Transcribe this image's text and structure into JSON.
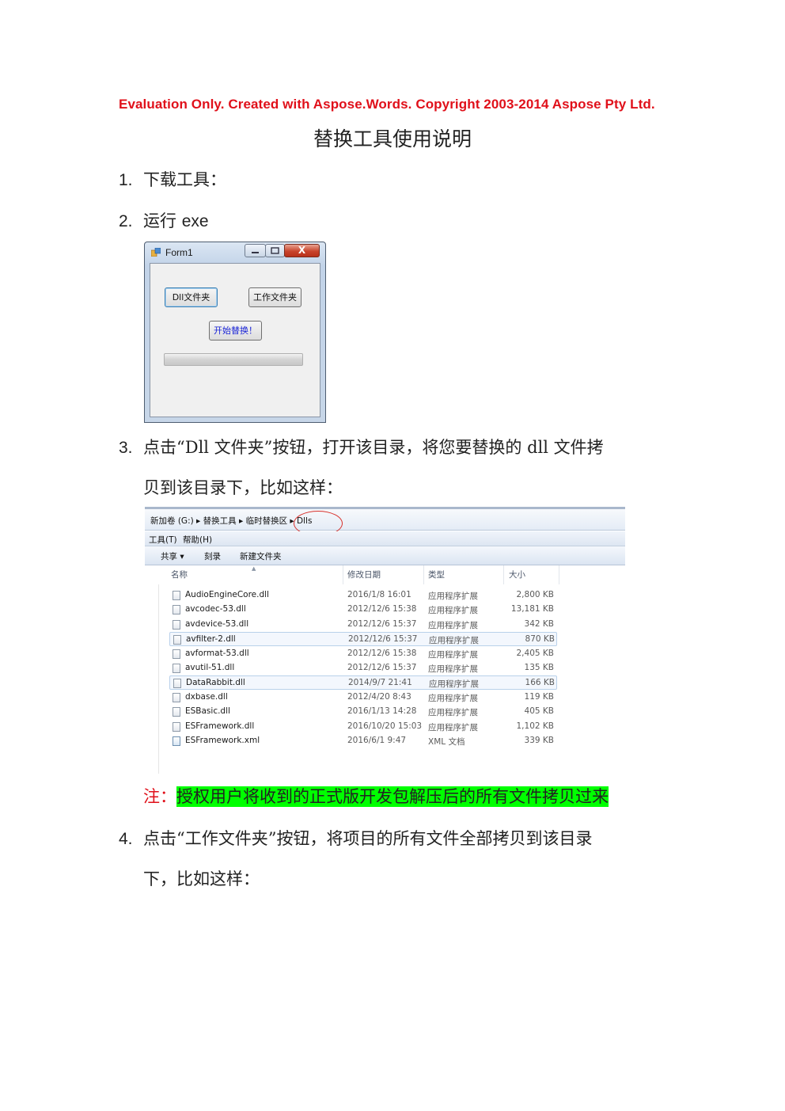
{
  "header": {
    "evaluation_notice": "Evaluation Only. Created with Aspose.Words. Copyright 2003-2014 Aspose Pty Ltd.",
    "title": "替换工具使用说明"
  },
  "steps": {
    "s1": {
      "num": "1.",
      "text": "下载工具："
    },
    "s2": {
      "num": "2.",
      "text_prefix": "运行 ",
      "text_latin": "exe"
    },
    "s3": {
      "num": "3.",
      "line1": "点击“Dll 文件夹”按钮，打开该目录，将您要替换的 dll 文件拷",
      "line2": "贝到该目录下，比如这样："
    },
    "s4": {
      "num": "4.",
      "line1": "点击“工作文件夹”按钮，将项目的所有文件全部拷贝到该目录",
      "line2": "下，比如这样："
    }
  },
  "form1": {
    "title": "Form1",
    "close_glyph": "X",
    "dll_button": "Dll文件夹",
    "work_button": "工作文件夹",
    "start_button": "开始替换！",
    "progress": 0
  },
  "explorer": {
    "breadcrumb": "新加卷 (G:) ▸ 替换工具 ▸ 临时替换区 ▸ Dlls",
    "menu": {
      "tools": "工具(T)",
      "help": "帮助(H)"
    },
    "toolbar": {
      "share": "共享 ▾",
      "burn": "刻录",
      "new_folder": "新建文件夹"
    },
    "columns": {
      "name": "名称",
      "date": "修改日期",
      "type": "类型",
      "size": "大小"
    },
    "files": [
      {
        "name": "AudioEngineCore.dll",
        "date": "2016/1/8 16:01",
        "type": "应用程序扩展",
        "size": "2,800 KB"
      },
      {
        "name": "avcodec-53.dll",
        "date": "2012/12/6 15:38",
        "type": "应用程序扩展",
        "size": "13,181 KB"
      },
      {
        "name": "avdevice-53.dll",
        "date": "2012/12/6 15:37",
        "type": "应用程序扩展",
        "size": "342 KB"
      },
      {
        "name": "avfilter-2.dll",
        "date": "2012/12/6 15:37",
        "type": "应用程序扩展",
        "size": "870 KB"
      },
      {
        "name": "avformat-53.dll",
        "date": "2012/12/6 15:38",
        "type": "应用程序扩展",
        "size": "2,405 KB"
      },
      {
        "name": "avutil-51.dll",
        "date": "2012/12/6 15:37",
        "type": "应用程序扩展",
        "size": "135 KB"
      },
      {
        "name": "DataRabbit.dll",
        "date": "2014/9/7 21:41",
        "type": "应用程序扩展",
        "size": "166 KB"
      },
      {
        "name": "dxbase.dll",
        "date": "2012/4/20 8:43",
        "type": "应用程序扩展",
        "size": "119 KB"
      },
      {
        "name": "ESBasic.dll",
        "date": "2016/1/13 14:28",
        "type": "应用程序扩展",
        "size": "405 KB"
      },
      {
        "name": "ESFramework.dll",
        "date": "2016/10/20 15:03",
        "type": "应用程序扩展",
        "size": "1,102 KB"
      },
      {
        "name": "ESFramework.xml",
        "date": "2016/6/1 9:47",
        "type": "XML 文档",
        "size": "339 KB"
      }
    ]
  },
  "note": {
    "label": "注：",
    "text": "授权用户将收到的正式版开发包解压后的所有文件拷贝过来"
  }
}
